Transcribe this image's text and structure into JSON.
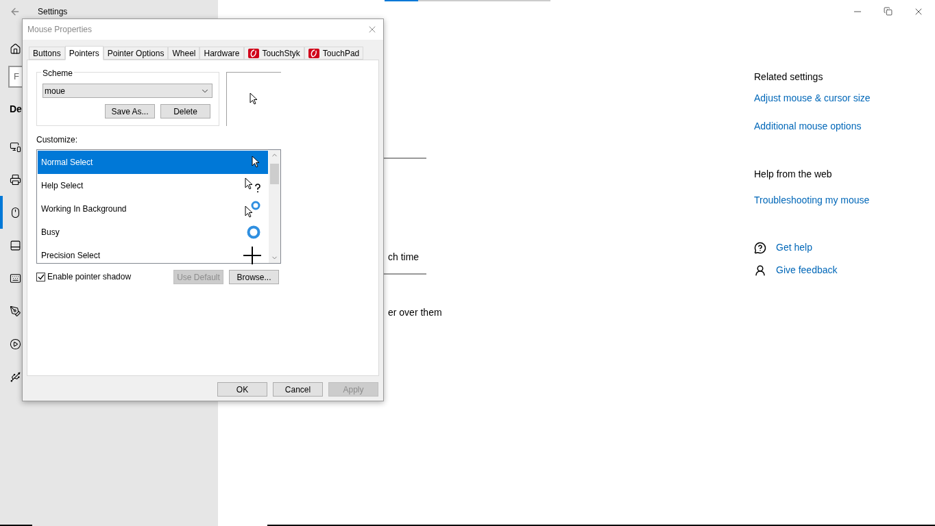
{
  "settings_window": {
    "title": "Settings",
    "search_partial": "F",
    "heading_partial": "De",
    "nav": [
      {
        "kind": "devices",
        "selected": false
      },
      {
        "kind": "printer",
        "selected": false
      },
      {
        "kind": "mouse",
        "selected": true
      },
      {
        "kind": "touchpad",
        "selected": false
      },
      {
        "kind": "keyboard",
        "selected": false
      },
      {
        "kind": "pen",
        "selected": false
      },
      {
        "kind": "autoplay",
        "selected": false
      },
      {
        "kind": "usb",
        "selected": false
      }
    ],
    "main_fragments": [
      "ch time",
      "er over them"
    ],
    "related": {
      "title": "Related settings",
      "links": [
        "Adjust mouse & cursor size",
        "Additional mouse options"
      ]
    },
    "help": {
      "title": "Help from the web",
      "links": [
        "Troubleshooting my mouse"
      ]
    },
    "actions": [
      {
        "kind": "help",
        "label": "Get help"
      },
      {
        "kind": "feedback",
        "label": "Give feedback"
      }
    ]
  },
  "dialog": {
    "title": "Mouse Properties",
    "tabs": [
      {
        "label": "Buttons",
        "selected": false,
        "kind": "plain"
      },
      {
        "label": "Pointers",
        "selected": true,
        "kind": "plain"
      },
      {
        "label": "Pointer Options",
        "selected": false,
        "kind": "plain"
      },
      {
        "label": "Wheel",
        "selected": false,
        "kind": "plain"
      },
      {
        "label": "Hardware",
        "selected": false,
        "kind": "plain"
      },
      {
        "label": "TouchStyk",
        "selected": false,
        "kind": "branded"
      },
      {
        "label": "TouchPad",
        "selected": false,
        "kind": "branded"
      }
    ],
    "scheme": {
      "label": "Scheme",
      "value": "moue",
      "buttons": [
        {
          "label": "Save As...",
          "disabled": false
        },
        {
          "label": "Delete",
          "disabled": false
        }
      ]
    },
    "customize": {
      "label": "Customize:",
      "rows": [
        {
          "label": "Normal Select",
          "kind": "arrow",
          "selected": true
        },
        {
          "label": "Help Select",
          "kind": "help",
          "selected": false
        },
        {
          "label": "Working In Background",
          "kind": "working",
          "selected": false
        },
        {
          "label": "Busy",
          "kind": "busy",
          "selected": false
        },
        {
          "label": "Precision Select",
          "kind": "cross",
          "selected": false
        }
      ]
    },
    "shadow": {
      "label": "Enable pointer shadow",
      "checked": true
    },
    "pointer_buttons": [
      {
        "label": "Use Default",
        "disabled": true
      },
      {
        "label": "Browse...",
        "disabled": false
      }
    ],
    "footer_buttons": [
      {
        "label": "OK",
        "disabled": false
      },
      {
        "label": "Cancel",
        "disabled": false
      },
      {
        "label": "Apply",
        "disabled": true
      }
    ]
  }
}
